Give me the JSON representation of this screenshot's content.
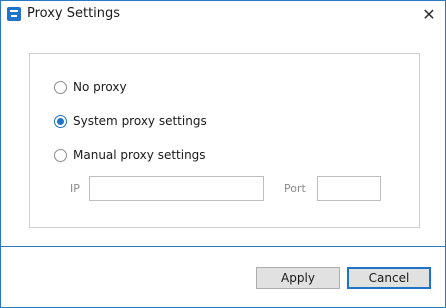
{
  "window": {
    "title": "Proxy Settings",
    "close_glyph": "✕",
    "accent": "#2b78c5"
  },
  "options": [
    {
      "label": "No proxy",
      "checked": false
    },
    {
      "label": "System proxy settings",
      "checked": true
    },
    {
      "label": "Manual proxy settings",
      "checked": false
    }
  ],
  "manual": {
    "ip_label": "IP",
    "ip_value": "",
    "port_label": "Port",
    "port_value": ""
  },
  "footer": {
    "apply_label": "Apply",
    "cancel_label": "Cancel"
  },
  "icons": {
    "app": "proxy-app-icon",
    "close": "close-icon"
  }
}
